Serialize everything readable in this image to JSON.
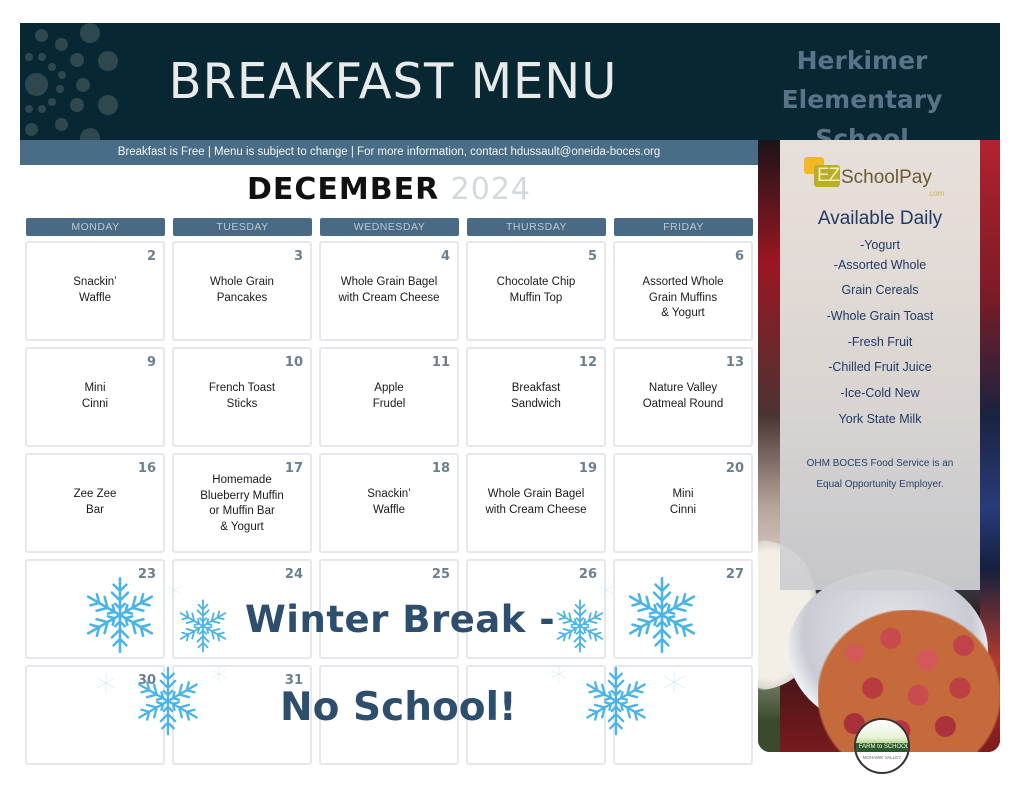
{
  "header": {
    "title": "BREAKFAST MENU",
    "school_line1": "Herkimer",
    "school_line2": "Elementary School",
    "subtitle": "Breakfast is Free  |  Menu is subject to change  |  For more information, contact hdussault@oneida-boces.org"
  },
  "calendar": {
    "month": "DECEMBER",
    "year": "2024",
    "weekdays": [
      "MONDAY",
      "TUESDAY",
      "WEDNESDAY",
      "THURSDAY",
      "FRIDAY"
    ],
    "weeks": [
      [
        {
          "day": "2",
          "item": "Snackin’\nWaffle"
        },
        {
          "day": "3",
          "item": "Whole Grain\nPancakes"
        },
        {
          "day": "4",
          "item": "Whole Grain Bagel\nwith Cream Cheese"
        },
        {
          "day": "5",
          "item": "Chocolate Chip\nMuffin Top"
        },
        {
          "day": "6",
          "item": "Assorted Whole\nGrain Muffins\n& Yogurt"
        }
      ],
      [
        {
          "day": "9",
          "item": "Mini\nCinni"
        },
        {
          "day": "10",
          "item": "French Toast\nSticks"
        },
        {
          "day": "11",
          "item": "Apple\nFrudel"
        },
        {
          "day": "12",
          "item": "Breakfast\nSandwich"
        },
        {
          "day": "13",
          "item": "Nature Valley\nOatmeal Round"
        }
      ],
      [
        {
          "day": "16",
          "item": "Zee Zee\nBar"
        },
        {
          "day": "17",
          "item": "Homemade\nBlueberry Muffin\nor Muffin Bar\n& Yogurt"
        },
        {
          "day": "18",
          "item": "Snackin’\nWaffle"
        },
        {
          "day": "19",
          "item": "Whole Grain Bagel\nwith Cream Cheese"
        },
        {
          "day": "20",
          "item": "Mini\nCinni"
        }
      ],
      [
        {
          "day": "23",
          "item": ""
        },
        {
          "day": "24",
          "item": ""
        },
        {
          "day": "25",
          "item": ""
        },
        {
          "day": "26",
          "item": ""
        },
        {
          "day": "27",
          "item": ""
        }
      ],
      [
        {
          "day": "30",
          "item": ""
        },
        {
          "day": "31",
          "item": ""
        },
        {
          "day": "",
          "item": ""
        },
        {
          "day": "",
          "item": ""
        },
        {
          "day": "",
          "item": ""
        }
      ]
    ],
    "break_line1": "Winter Break -",
    "break_line2": "No School!"
  },
  "sidebar": {
    "logo_ez": "EZ",
    "logo_name": "SchoolPay",
    "logo_domain": ".com",
    "available_title": "Available Daily",
    "daily_items": [
      "-Yogurt",
      "-Assorted Whole",
      "Grain Cereals",
      "-Whole Grain Toast",
      "-Fresh Fruit",
      "-Chilled Fruit Juice",
      "-Ice-Cold New",
      "York State Milk"
    ],
    "eoe_line1": "OHM BOCES Food Service is an",
    "eoe_line2": "Equal Opportunity Employer.",
    "farm_banner": "FARM to SCHOOL",
    "farm_region": "MOHAWK VALLEY"
  },
  "colors": {
    "header_bg": "#072733",
    "subbar_bg": "#496d86",
    "weekday_bg": "#496a84",
    "snowflake": "#4bb3e6",
    "break_text": "#2e4e6e",
    "sidebar_text": "#1f3a66"
  }
}
